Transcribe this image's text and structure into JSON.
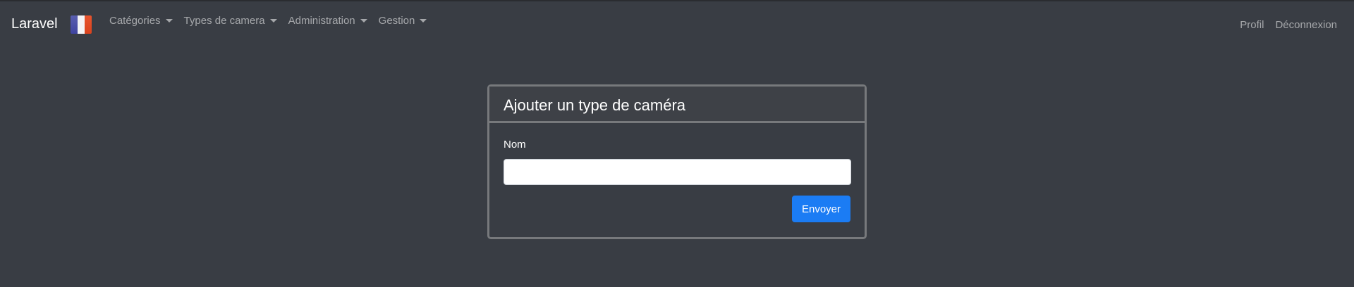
{
  "navbar": {
    "brand": "Laravel",
    "flag_icon": "france-flag-icon",
    "menu": [
      {
        "label": "Catégories"
      },
      {
        "label": "Types de camera"
      },
      {
        "label": "Administration"
      },
      {
        "label": "Gestion"
      }
    ],
    "right": [
      {
        "label": "Profil"
      },
      {
        "label": "Déconnexion"
      }
    ]
  },
  "card": {
    "title": "Ajouter un type de caméra",
    "name_label": "Nom",
    "name_value": "",
    "submit_label": "Envoyer"
  },
  "colors": {
    "background": "#393d44",
    "accent": "#1b7cf4",
    "card_border": "#77797c"
  }
}
